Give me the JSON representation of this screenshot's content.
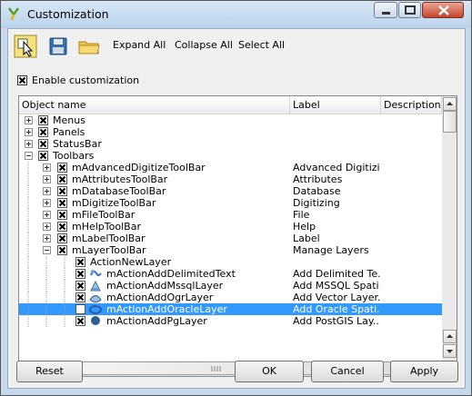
{
  "window": {
    "title": "Customization"
  },
  "toolbar": {
    "expand_all": "Expand All",
    "collapse_all": "Collapse All",
    "select_all": "Select All"
  },
  "enable_customization": {
    "label": "Enable customization",
    "checked": true
  },
  "tree": {
    "columns": [
      "Object name",
      "Label",
      "Description"
    ],
    "rows": [
      {
        "name": "Menus",
        "label": "",
        "level": 0,
        "expander": "plus",
        "checked": true
      },
      {
        "name": "Panels",
        "label": "",
        "level": 0,
        "expander": "plus",
        "checked": true
      },
      {
        "name": "StatusBar",
        "label": "",
        "level": 0,
        "expander": "plus",
        "checked": true
      },
      {
        "name": "Toolbars",
        "label": "",
        "level": 0,
        "expander": "minus",
        "checked": true
      },
      {
        "name": "mAdvancedDigitizeToolBar",
        "label": "Advanced Digitizing",
        "level": 1,
        "expander": "plus",
        "checked": true
      },
      {
        "name": "mAttributesToolBar",
        "label": "Attributes",
        "level": 1,
        "expander": "plus",
        "checked": true
      },
      {
        "name": "mDatabaseToolBar",
        "label": "Database",
        "level": 1,
        "expander": "plus",
        "checked": true
      },
      {
        "name": "mDigitizeToolBar",
        "label": "Digitizing",
        "level": 1,
        "expander": "plus",
        "checked": true
      },
      {
        "name": "mFileToolBar",
        "label": "File",
        "level": 1,
        "expander": "plus",
        "checked": true
      },
      {
        "name": "mHelpToolBar",
        "label": "Help",
        "level": 1,
        "expander": "plus",
        "checked": true
      },
      {
        "name": "mLabelToolBar",
        "label": "Label",
        "level": 1,
        "expander": "plus",
        "checked": true
      },
      {
        "name": "mLayerToolBar",
        "label": "Manage Layers",
        "level": 1,
        "expander": "minus",
        "checked": true
      },
      {
        "name": "ActionNewLayer",
        "label": "",
        "level": 2,
        "expander": "none",
        "checked": true,
        "icon": "none"
      },
      {
        "name": "mActionAddDelimitedText",
        "label": "Add Delimited Te...",
        "level": 2,
        "expander": "none",
        "checked": true,
        "icon": "delimited-text-icon"
      },
      {
        "name": "mActionAddMssqlLayer",
        "label": "Add MSSQL Spati...",
        "level": 2,
        "expander": "none",
        "checked": true,
        "icon": "mssql-layer-icon"
      },
      {
        "name": "mActionAddOgrLayer",
        "label": "Add Vector Layer...",
        "level": 2,
        "expander": "none",
        "checked": true,
        "icon": "vector-layer-icon"
      },
      {
        "name": "mActionAddOracleLayer",
        "label": "Add Oracle Spati...",
        "level": 2,
        "expander": "none",
        "checked": false,
        "icon": "oracle-layer-icon",
        "selected": true
      },
      {
        "name": "mActionAddPgLayer",
        "label": "Add PostGIS Lay...",
        "level": 2,
        "expander": "none",
        "checked": true,
        "icon": "postgis-layer-icon"
      }
    ]
  },
  "buttons": {
    "reset": "Reset",
    "ok": "OK",
    "cancel": "Cancel",
    "apply": "Apply"
  }
}
